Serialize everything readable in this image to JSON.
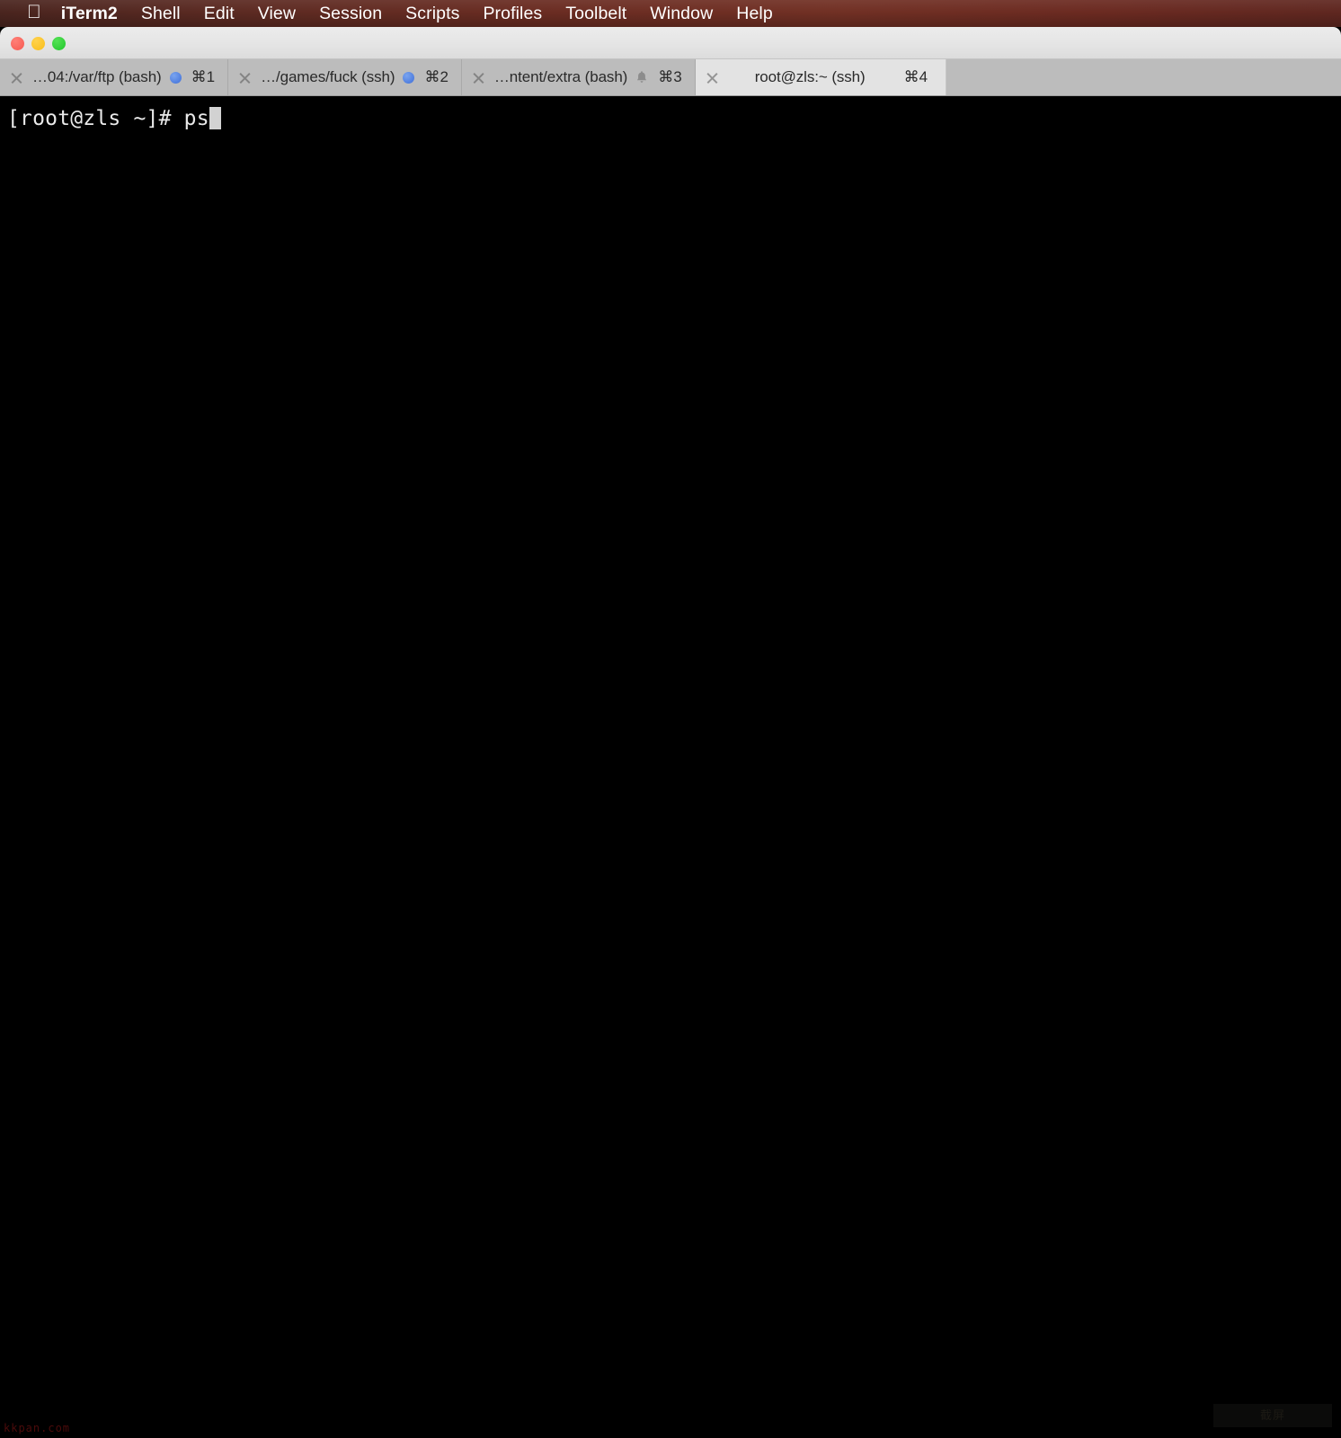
{
  "menubar": {
    "apple_icon": "apple-logo-icon",
    "items": [
      {
        "label": "iTerm2",
        "bold": true
      },
      {
        "label": "Shell",
        "bold": false
      },
      {
        "label": "Edit",
        "bold": false
      },
      {
        "label": "View",
        "bold": false
      },
      {
        "label": "Session",
        "bold": false
      },
      {
        "label": "Scripts",
        "bold": false
      },
      {
        "label": "Profiles",
        "bold": false
      },
      {
        "label": "Toolbelt",
        "bold": false
      },
      {
        "label": "Window",
        "bold": false
      },
      {
        "label": "Help",
        "bold": false
      }
    ],
    "background_color": "#6b2c22",
    "text_color": "#ffffff"
  },
  "window_controls": {
    "close_label": "close",
    "minimize_label": "minimize",
    "zoom_label": "zoom",
    "close_color": "#f6584f",
    "minimize_color": "#f9bd19",
    "zoom_color": "#20c62b"
  },
  "tabs": [
    {
      "title": "…04:/var/ftp (bash)",
      "shortcut": "⌘1",
      "indicator": "blue-dot",
      "active": false
    },
    {
      "title": "…/games/fuck (ssh)",
      "shortcut": "⌘2",
      "indicator": "blue-dot",
      "active": false
    },
    {
      "title": "…ntent/extra (bash)",
      "shortcut": "⌘3",
      "indicator": "bell",
      "active": false
    },
    {
      "title": "root@zls:~ (ssh)",
      "shortcut": "⌘4",
      "indicator": "none",
      "active": true
    }
  ],
  "terminal": {
    "prompt": "[root@zls ~]# ",
    "typed_command": "ps",
    "background_color": "#000000",
    "text_color": "#e9e9e9",
    "cursor_color": "#d2d2d2"
  },
  "watermarks": {
    "bottom_left": "kkpan.com",
    "bottom_right": "截屏"
  }
}
